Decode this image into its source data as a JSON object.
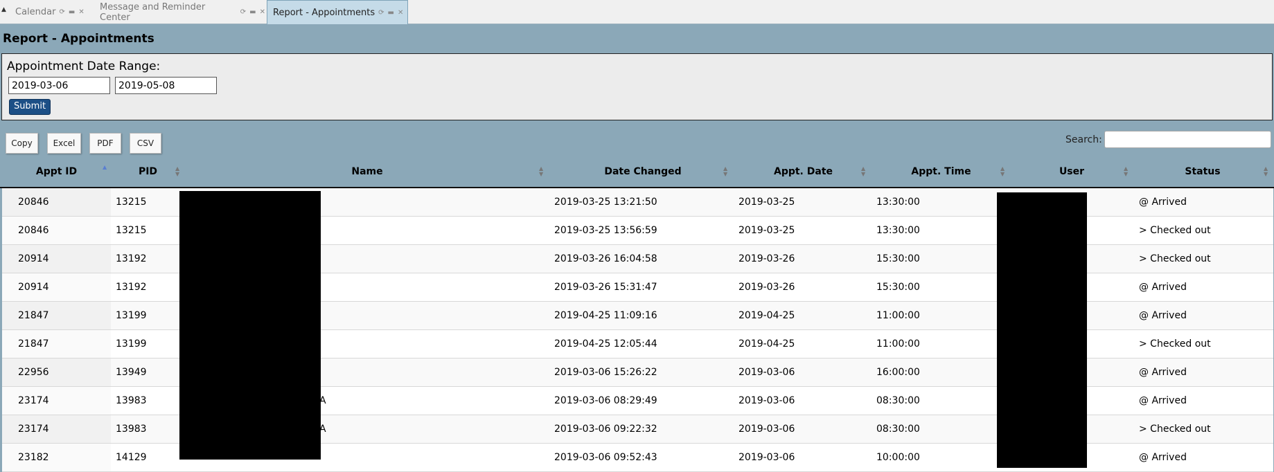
{
  "tabs": [
    {
      "label": "Calendar",
      "active": false
    },
    {
      "label": "Message and Reminder Center",
      "active": false
    },
    {
      "label": "Report - Appointments",
      "active": true
    }
  ],
  "page_title": "Report - Appointments",
  "date_range": {
    "label": "Appointment Date Range:",
    "from": "2019-03-06",
    "to": "2019-05-08",
    "submit_label": "Submit"
  },
  "export_buttons": [
    "Copy",
    "Excel",
    "PDF",
    "CSV"
  ],
  "search": {
    "label": "Search:",
    "value": ""
  },
  "table": {
    "columns": [
      "Appt ID",
      "PID",
      "Name",
      "Date Changed",
      "Appt. Date",
      "Appt. Time",
      "User",
      "Status"
    ],
    "rows": [
      {
        "appt_id": "20846",
        "pid": "13215",
        "name_visible": "",
        "date_changed": "2019-03-25 13:21:50",
        "appt_date": "2019-03-25",
        "appt_time": "13:30:00",
        "status": "@ Arrived"
      },
      {
        "appt_id": "20846",
        "pid": "13215",
        "name_visible": "",
        "date_changed": "2019-03-25 13:56:59",
        "appt_date": "2019-03-25",
        "appt_time": "13:30:00",
        "status": "> Checked out"
      },
      {
        "appt_id": "20914",
        "pid": "13192",
        "name_visible": "",
        "date_changed": "2019-03-26 16:04:58",
        "appt_date": "2019-03-26",
        "appt_time": "15:30:00",
        "status": "> Checked out"
      },
      {
        "appt_id": "20914",
        "pid": "13192",
        "name_visible": "",
        "date_changed": "2019-03-26 15:31:47",
        "appt_date": "2019-03-26",
        "appt_time": "15:30:00",
        "status": "@ Arrived"
      },
      {
        "appt_id": "21847",
        "pid": "13199",
        "name_visible": "",
        "date_changed": "2019-04-25 11:09:16",
        "appt_date": "2019-04-25",
        "appt_time": "11:00:00",
        "status": "@ Arrived"
      },
      {
        "appt_id": "21847",
        "pid": "13199",
        "name_visible": "",
        "date_changed": "2019-04-25 12:05:44",
        "appt_date": "2019-04-25",
        "appt_time": "11:00:00",
        "status": "> Checked out"
      },
      {
        "appt_id": "22956",
        "pid": "13949",
        "name_visible": "",
        "date_changed": "2019-03-06 15:26:22",
        "appt_date": "2019-03-06",
        "appt_time": "16:00:00",
        "status": "@ Arrived"
      },
      {
        "appt_id": "23174",
        "pid": "13983",
        "name_visible": "A",
        "date_changed": "2019-03-06 08:29:49",
        "appt_date": "2019-03-06",
        "appt_time": "08:30:00",
        "status": "@ Arrived"
      },
      {
        "appt_id": "23174",
        "pid": "13983",
        "name_visible": "A",
        "date_changed": "2019-03-06 09:22:32",
        "appt_date": "2019-03-06",
        "appt_time": "08:30:00",
        "status": "> Checked out"
      },
      {
        "appt_id": "23182",
        "pid": "14129",
        "name_visible": "",
        "date_changed": "2019-03-06 09:52:43",
        "appt_date": "2019-03-06",
        "appt_time": "10:00:00",
        "status": "@ Arrived"
      }
    ]
  },
  "colors": {
    "page_bg": "#8ba8b8",
    "panel_bg": "#ececec",
    "submit_bg": "#1c4f86",
    "active_tab_bg": "#c5dbe8",
    "redaction": "#000000"
  }
}
